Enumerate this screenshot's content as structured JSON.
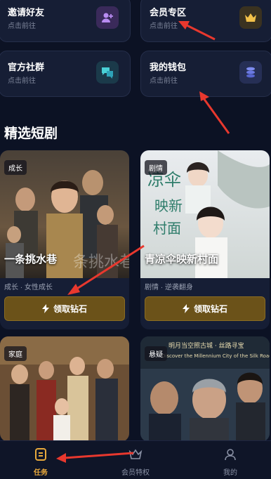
{
  "cards": [
    {
      "title": "邀请好友",
      "sub": "点击前往",
      "icon": "add-user-icon"
    },
    {
      "title": "会员专区",
      "sub": "点击前往",
      "icon": "crown-icon"
    },
    {
      "title": "官方社群",
      "sub": "点击前往",
      "icon": "chat-icon"
    },
    {
      "title": "我的钱包",
      "sub": "点击前往",
      "icon": "coins-icon"
    }
  ],
  "section_title": "精选短剧",
  "dramas": [
    {
      "tag": "成长",
      "name": "一条挑水巷",
      "genre": "成长 · 女性成长",
      "button": "领取钻石"
    },
    {
      "tag": "剧情",
      "name": "青凉伞映新村面",
      "genre": "剧情 · 逆袭翻身",
      "button": "领取钻石"
    },
    {
      "tag": "家庭"
    },
    {
      "tag": "悬疑"
    }
  ],
  "tabs": [
    {
      "label": "任务",
      "icon": "task-icon"
    },
    {
      "label": "会员特权",
      "icon": "crown-icon"
    },
    {
      "label": "我的",
      "icon": "user-icon"
    }
  ],
  "colors": {
    "accent": "#e8a93c",
    "background": "#0c1224",
    "annotation": "#e8382e"
  }
}
